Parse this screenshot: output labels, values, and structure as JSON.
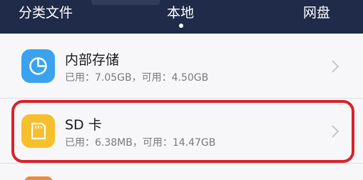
{
  "tabs": {
    "classify": "分类文件",
    "local": "本地",
    "cloud": "网盘"
  },
  "storage": {
    "internal": {
      "title": "内部存储",
      "usage": "已用：7.05GB，可用：4.50GB",
      "icon": "pie-chart-icon",
      "color": "#3aa2ee"
    },
    "sd": {
      "title": "SD 卡",
      "usage": "已用：6.38MB，可用：14.47GB",
      "icon": "sd-card-icon",
      "color": "#f7bf2b"
    }
  },
  "colors": {
    "topbar": "#1f2b48",
    "highlight": "#d9222a"
  }
}
